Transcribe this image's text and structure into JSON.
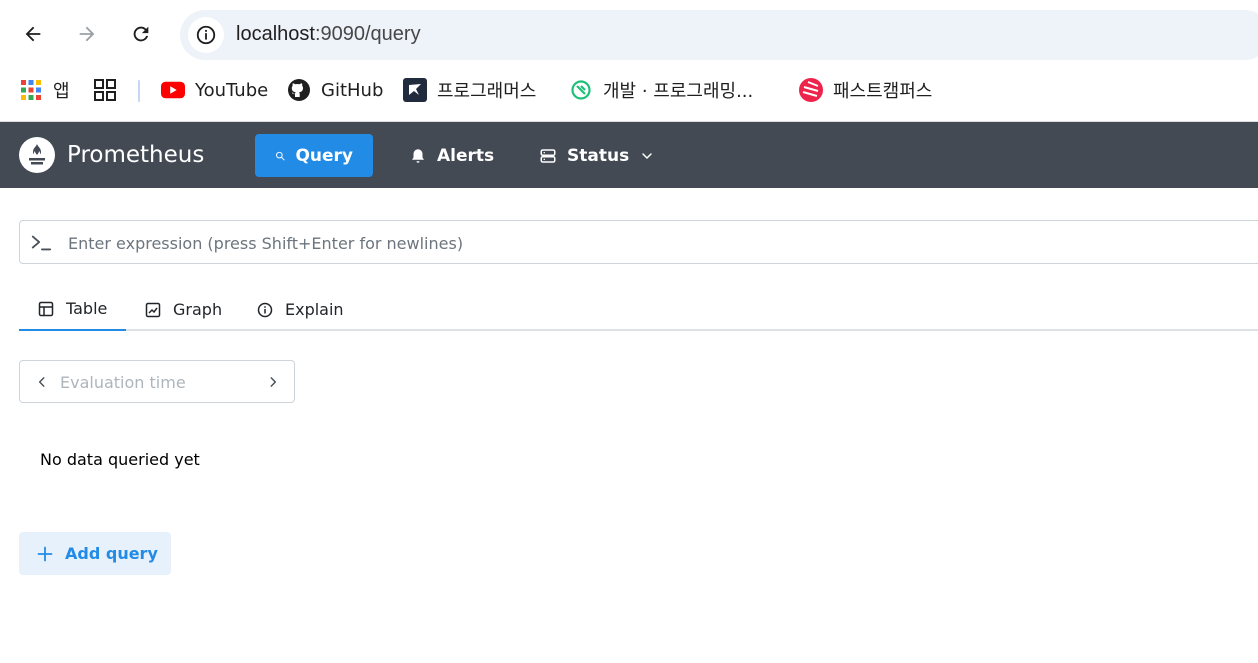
{
  "browser": {
    "url_host": "localhost",
    "url_path": ":9090/query",
    "bookmarks": [
      {
        "label": "앱",
        "icon": "apps-grid-icon"
      },
      {
        "label": "",
        "icon": "tab-groups-icon"
      },
      {
        "label": "YouTube",
        "icon": "youtube-icon"
      },
      {
        "label": "GitHub",
        "icon": "github-icon"
      },
      {
        "label": "프로그래머스",
        "icon": "programmers-icon"
      },
      {
        "label": "개발 · 프로그래밍...",
        "icon": "inflearn-icon"
      },
      {
        "label": "패스트캠퍼스",
        "icon": "fastcampus-icon"
      }
    ]
  },
  "navbar": {
    "brand": "Prometheus",
    "links": [
      {
        "label": "Query",
        "icon": "search-icon",
        "active": true
      },
      {
        "label": "Alerts",
        "icon": "bell-icon",
        "active": false
      },
      {
        "label": "Status",
        "icon": "server-icon",
        "active": false
      }
    ]
  },
  "query": {
    "expression_placeholder": "Enter expression (press Shift+Enter for newlines)",
    "expression_value": "",
    "tabs": [
      {
        "label": "Table",
        "icon": "table-icon",
        "active": true
      },
      {
        "label": "Graph",
        "icon": "chart-icon",
        "active": false
      },
      {
        "label": "Explain",
        "icon": "info-icon",
        "active": false
      }
    ],
    "eval_time_placeholder": "Evaluation time",
    "empty_message": "No data queried yet",
    "add_query_label": "Add query"
  },
  "colors": {
    "navbar_bg": "#434a54",
    "accent": "#228be6",
    "add_query_bg": "#e7f1fc"
  }
}
